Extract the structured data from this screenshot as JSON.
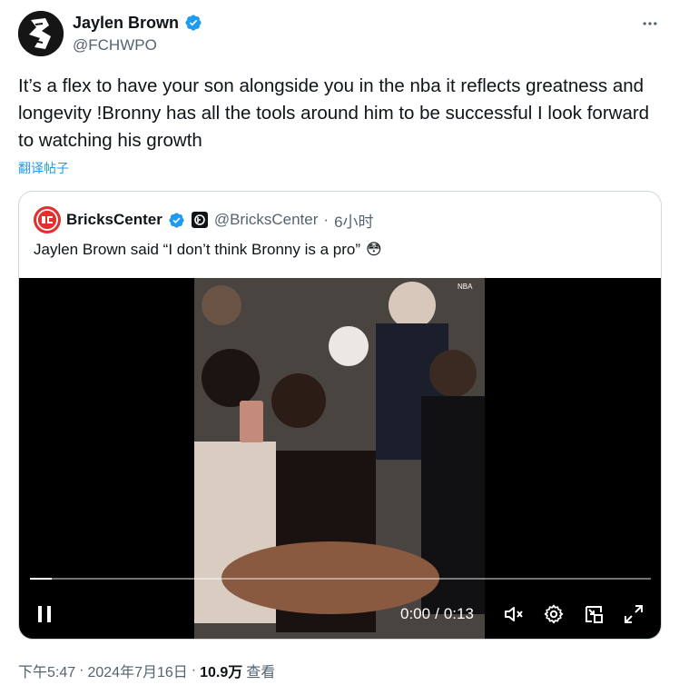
{
  "tweet": {
    "author": {
      "display_name": "Jaylen Brown",
      "handle": "@FCHWPO",
      "avatar_icon": "liberation-logo-avatar",
      "verified": true
    },
    "text": "It’s a flex to have your son alongside you in the nba it reflects greatness and longevity !Bronny has all the tools around him to be successful I look forward to watching his growth",
    "translate_label": "翻译帖子",
    "quoted": {
      "display_name": "BricksCenter",
      "handle": "@BricksCenter",
      "separator": "·",
      "time_ago": "6小时",
      "text": "Jaylen Brown said “I don’t think Bronny is a pro”",
      "emoji": "😳",
      "video": {
        "current_time": "0:00",
        "time_divider": "/",
        "duration": "0:13",
        "progress_fraction": 0.035
      }
    },
    "meta": {
      "time": "下午5:47",
      "dot1": "·",
      "date": "2024年7月16日",
      "dot2": "·",
      "views": "10.9万",
      "views_label": "查看"
    }
  },
  "colors": {
    "accent_blue": "#1d9bf0",
    "text_primary": "#0f1419",
    "text_secondary": "#536471",
    "border": "#cfd9de",
    "bricks_red": "#e0312f"
  }
}
